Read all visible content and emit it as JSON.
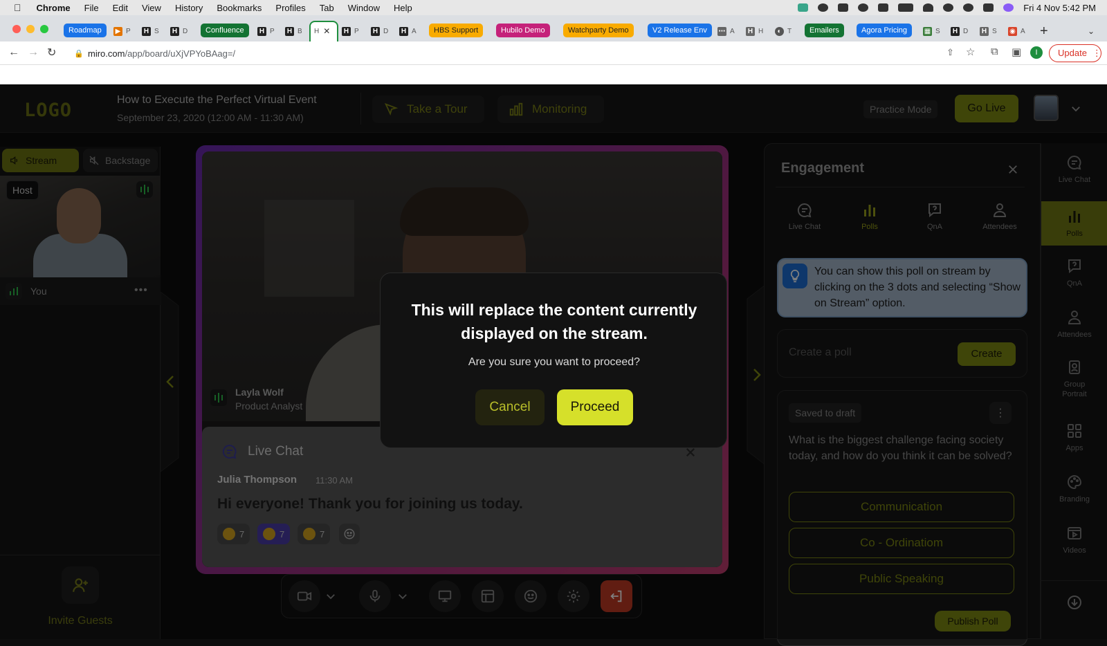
{
  "menubar": {
    "app_name": "Chrome",
    "items": [
      "File",
      "Edit",
      "View",
      "History",
      "Bookmarks",
      "Profiles",
      "Tab",
      "Window",
      "Help"
    ],
    "clock": "Fri 4 Nov  5:42 PM"
  },
  "tabs": {
    "pills": [
      {
        "label": "Roadmap",
        "color": "#1a73e8"
      },
      {
        "label": "Confluence",
        "color": "#137333"
      },
      {
        "label": "HBS Support",
        "color": "#f9ab00"
      },
      {
        "label": "Hubilo Demo",
        "color": "#c5227a"
      },
      {
        "label": "Watchparty Demo",
        "color": "#f9ab00"
      },
      {
        "label": "V2 Release Env",
        "color": "#1a73e8"
      },
      {
        "label": "Emailers",
        "color": "#137333"
      },
      {
        "label": "Agora Pricing",
        "color": "#1a73e8"
      }
    ],
    "small_letters": [
      "P",
      "S",
      "D",
      "P",
      "B",
      "H",
      "P",
      "D",
      "A",
      "A",
      "H",
      "T",
      "S",
      "D",
      "S",
      "A"
    ]
  },
  "addressbar": {
    "url_host": "miro.com",
    "url_path": "/app/board/uXjVPYoBAag=/",
    "update_label": "Update"
  },
  "header": {
    "logo": "LOGO",
    "event_title": "How to Execute the Perfect Virtual Event",
    "event_date": "September 23, 2020 (12:00 AM - 11:30 AM)",
    "tour_label": "Take a Tour",
    "monitoring_label": "Monitoring",
    "practice_label": "Practice Mode",
    "golive_label": "Go Live"
  },
  "left_panel": {
    "stream_tab": "Stream",
    "backstage_tab": "Backstage",
    "host_label": "Host",
    "you_label": "You",
    "more_label": "•••",
    "invite_label": "Invite Guests"
  },
  "stage": {
    "speaker_name": "Layla Wolf",
    "speaker_role": "Product Analyst"
  },
  "chat": {
    "title": "Live Chat",
    "user": "Julia Thompson",
    "time": "11:30 AM",
    "message": "Hi everyone! Thank you for joining us today.",
    "reactions": [
      {
        "count": "7"
      },
      {
        "count": "7"
      },
      {
        "count": "7"
      }
    ]
  },
  "engagement": {
    "title": "Engagement",
    "tabs": [
      "Live Chat",
      "Polls",
      "QnA",
      "Attendees"
    ],
    "tip": "You can show this poll on stream by clicking on the 3 dots and selecting “Show on Stream” option.",
    "create_placeholder": "Create a poll",
    "create_label": "Create",
    "draft_label": "Saved to draft",
    "question": "What is the biggest challenge facing society today, and how do you think it can be solved?",
    "options": [
      "Communication",
      "Co - Ordinatiom",
      "Public Speaking"
    ],
    "publish_label": "Publish Poll"
  },
  "rail": {
    "items": [
      "Live Chat",
      "Polls",
      "QnA",
      "Attendees",
      "Group Portrait",
      "Apps",
      "Branding",
      "Videos"
    ]
  },
  "modal": {
    "title": "This will replace the content currently displayed on the stream.",
    "subtitle": "Are you sure you want to proceed?",
    "cancel_label": "Cancel",
    "proceed_label": "Proceed"
  }
}
